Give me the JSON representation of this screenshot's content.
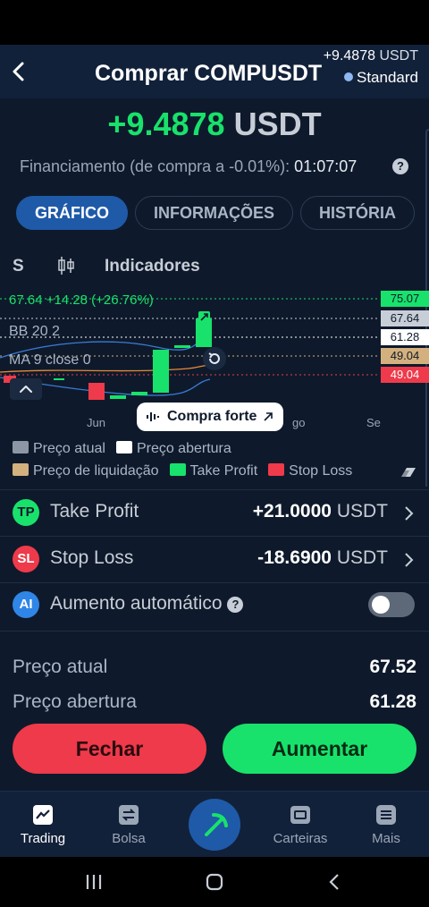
{
  "header": {
    "title": "Comprar COMPUSDT",
    "pnl_value": "+9.4878",
    "pnl_unit": "USDT",
    "account": "Standard"
  },
  "summary": {
    "pnl_value": "+9.4878",
    "pnl_unit": "USDT",
    "funding_label": "Financiamento (de compra a -0.01%):",
    "funding_time": "01:07:07",
    "help_glyph": "?"
  },
  "tabs": [
    {
      "label": "GRÁFICO",
      "active": true
    },
    {
      "label": "INFORMAÇÕES",
      "active": false
    },
    {
      "label": "HISTÓRIA",
      "active": false
    }
  ],
  "chart_tools": {
    "timeframe": "S",
    "indicators": "Indicadores"
  },
  "chart": {
    "price_info": "67.64  +14.28 (+26.76%)",
    "bb_label": "BB 20 2",
    "ma_label": "MA 9 close 0",
    "x_labels": [
      "Jun",
      "go",
      "Se"
    ],
    "signal": "Compra forte",
    "price_tags": {
      "take_profit": "75.07",
      "current": "67.64",
      "open": "61.28",
      "liquidation": "49.04",
      "stop_loss": "49.04"
    },
    "colors": {
      "up": "#18e26b",
      "down": "#ee3a4a",
      "current": "#c8ced7",
      "open": "#ffffff",
      "liquidation": "#d4b07e"
    }
  },
  "legend": [
    {
      "label": "Preço atual",
      "color": "#8c96a5"
    },
    {
      "label": "Preço abertura",
      "color": "#ffffff"
    },
    {
      "label": "Preço de liquidação",
      "color": "#d4b07e"
    },
    {
      "label": "Take Profit",
      "color": "#18e26b"
    },
    {
      "label": "Stop Loss",
      "color": "#ee3a4a"
    }
  ],
  "orders": {
    "take_profit": {
      "icon": "TP",
      "label": "Take Profit",
      "value": "+21.0000",
      "unit": "USDT"
    },
    "stop_loss": {
      "icon": "SL",
      "label": "Stop Loss",
      "value": "-18.6900",
      "unit": "USDT"
    },
    "auto_increase": {
      "icon": "AI",
      "label": "Aumento automático",
      "enabled": false
    }
  },
  "prices": {
    "current_label": "Preço atual",
    "current_value": "67.52",
    "open_label": "Preço abertura",
    "open_value": "61.28"
  },
  "actions": {
    "close": "Fechar",
    "increase": "Aumentar"
  },
  "bottom_nav": [
    {
      "label": "Trading",
      "icon": "trading-chart-icon",
      "active": true
    },
    {
      "label": "Bolsa",
      "icon": "exchange-icon",
      "active": false
    },
    {
      "label": "",
      "icon": "pickaxe-icon",
      "active": false
    },
    {
      "label": "Carteiras",
      "icon": "wallet-icon",
      "active": false
    },
    {
      "label": "Mais",
      "icon": "menu-icon",
      "active": false
    }
  ]
}
